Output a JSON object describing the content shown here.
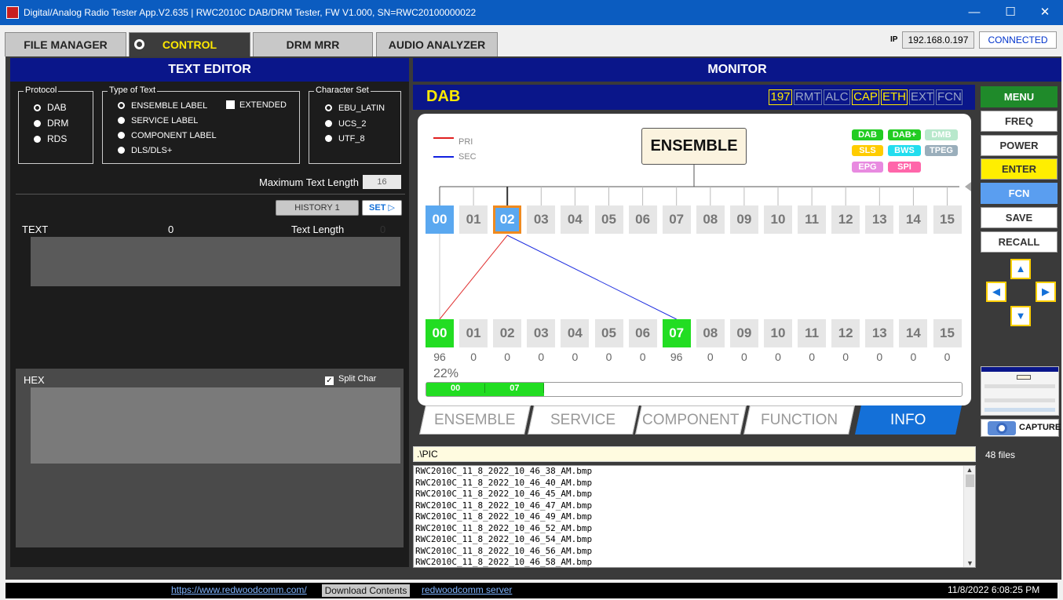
{
  "window": {
    "title": "Digital/Analog Radio Tester App.V2.635 | RWC2010C DAB/DRM Tester, FW V1.000, SN=RWC20100000022",
    "minimize": "—",
    "maximize": "☐",
    "close": "✕"
  },
  "tabs": [
    "FILE MANAGER",
    "CONTROL",
    "DRM MRR",
    "AUDIO ANALYZER"
  ],
  "active_tab": "CONTROL",
  "connection": {
    "ip_label": "IP",
    "ip": "192.168.0.197",
    "status": "CONNECTED"
  },
  "text_editor": {
    "header": "TEXT EDITOR",
    "protocol": {
      "legend": "Protocol",
      "options": [
        "DAB",
        "DRM",
        "RDS"
      ],
      "selected": "DAB"
    },
    "type_of_text": {
      "legend": "Type of Text",
      "options": [
        "ENSEMBLE LABEL",
        "SERVICE LABEL",
        "COMPONENT LABEL",
        "DLS/DLS+"
      ],
      "selected": "ENSEMBLE LABEL",
      "extended_label": "EXTENDED"
    },
    "charset": {
      "legend": "Character Set",
      "options": [
        "EBU_LATIN",
        "UCS_2",
        "UTF_8"
      ],
      "selected": "EBU_LATIN"
    },
    "max_len_label": "Maximum Text Length",
    "max_len_value": "16",
    "history_button": "HISTORY 1",
    "set_button": "SET ▷",
    "text_label": "TEXT",
    "text_count": "0",
    "text_length_label": "Text Length",
    "text_length_value": "0",
    "hex_label": "HEX",
    "split_char_label": "Split Char"
  },
  "monitor": {
    "header": "MONITOR",
    "mode": "DAB",
    "badges": [
      {
        "label": "197",
        "active": true
      },
      {
        "label": "RMT",
        "active": false
      },
      {
        "label": "ALC",
        "active": false
      },
      {
        "label": "CAP",
        "active": true
      },
      {
        "label": "ETH",
        "active": true
      },
      {
        "label": "EXT",
        "active": false
      },
      {
        "label": "FCN",
        "active": false
      }
    ],
    "legend": {
      "pri": "PRI",
      "sec": "SEC"
    },
    "ensemble_label": "ENSEMBLE",
    "tags": [
      {
        "label": "DAB",
        "color": "#22cc22"
      },
      {
        "label": "DAB+",
        "color": "#22cc22"
      },
      {
        "label": "DMB",
        "color": "#b8e8cc"
      },
      {
        "label": "SLS",
        "color": "#ffcc00"
      },
      {
        "label": "BWS",
        "color": "#22ddee"
      },
      {
        "label": "TPEG",
        "color": "#9aaebb"
      },
      {
        "label": "EPG",
        "color": "#e88ae0"
      },
      {
        "label": "SPI",
        "color": "#ff66aa"
      }
    ],
    "services": [
      "00",
      "01",
      "02",
      "03",
      "04",
      "05",
      "06",
      "07",
      "08",
      "09",
      "10",
      "11",
      "12",
      "13",
      "14",
      "15"
    ],
    "components": [
      "00",
      "01",
      "02",
      "03",
      "04",
      "05",
      "06",
      "07",
      "08",
      "09",
      "10",
      "11",
      "12",
      "13",
      "14",
      "15"
    ],
    "component_counts": [
      "96",
      "0",
      "0",
      "0",
      "0",
      "0",
      "0",
      "96",
      "0",
      "0",
      "0",
      "0",
      "0",
      "0",
      "0",
      "0"
    ],
    "percent": "22%",
    "progress": {
      "fraction": 0.22,
      "segments": [
        "00",
        "07"
      ]
    },
    "bottom_tabs": [
      "ENSEMBLE",
      "SERVICE",
      "COMPONENT",
      "FUNCTION",
      "INFO"
    ],
    "active_bottom_tab": "INFO"
  },
  "right_buttons": [
    "MENU",
    "FREQ",
    "POWER",
    "ENTER",
    "FCN",
    "SAVE",
    "RECALL"
  ],
  "capture_label": "CAPTURE",
  "files": {
    "path": ".\\PIC",
    "count": "48 files",
    "list": [
      "RWC2010C_11_8_2022_10_46_38_AM.bmp",
      "RWC2010C_11_8_2022_10_46_40_AM.bmp",
      "RWC2010C_11_8_2022_10_46_45_AM.bmp",
      "RWC2010C_11_8_2022_10_46_47_AM.bmp",
      "RWC2010C_11_8_2022_10_46_49_AM.bmp",
      "RWC2010C_11_8_2022_10_46_52_AM.bmp",
      "RWC2010C_11_8_2022_10_46_54_AM.bmp",
      "RWC2010C_11_8_2022_10_46_56_AM.bmp",
      "RWC2010C_11_8_2022_10_46_58_AM.bmp"
    ]
  },
  "statusbar": {
    "link1": "https://www.redwoodcomm.com/",
    "download": "Download Contents",
    "link2": "redwoodcomm server",
    "datetime": "11/8/2022 6:08:25 PM"
  }
}
